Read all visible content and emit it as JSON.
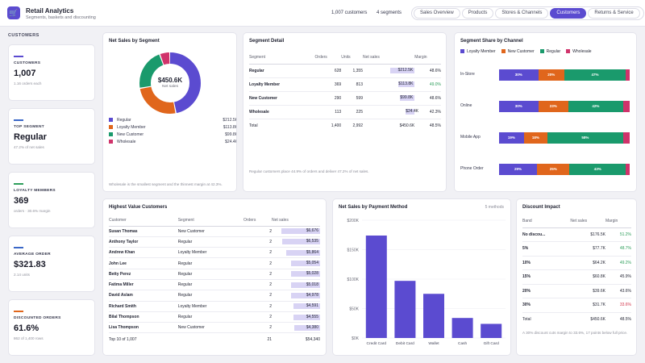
{
  "app": {
    "title": "Retail Analytics",
    "subtitle": "Segments, baskets and discounting"
  },
  "header_stats": {
    "customers": "1,007 customers",
    "segments": "4 segments"
  },
  "tabs": [
    {
      "label": "Sales Overview",
      "active": false
    },
    {
      "label": "Products",
      "active": false
    },
    {
      "label": "Stores & Channels",
      "active": false
    },
    {
      "label": "Customers",
      "active": true
    },
    {
      "label": "Returns & Service",
      "active": false
    }
  ],
  "sidebar": {
    "heading": "CUSTOMERS",
    "kpis": [
      {
        "label": "CUSTOMERS",
        "value": "1,007",
        "sub": "1.16 orders each",
        "color": "#5b4bd0"
      },
      {
        "label": "TOP SEGMENT",
        "value": "Regular",
        "sub": "47.2% of net sales",
        "color": "#3a67c7"
      },
      {
        "label": "LOYALTY MEMBERS",
        "value": "369",
        "sub": "orders · 30.6% margin",
        "color": "#2e9e5b"
      },
      {
        "label": "AVERAGE ORDER",
        "value": "$321.83",
        "sub": "2.14 units",
        "color": "#3a67c7"
      },
      {
        "label": "DISCOUNTED ORDERS",
        "value": "61.6%",
        "sub": "862 of 1,400 rows",
        "color": "#e0661c"
      }
    ]
  },
  "net_sales_by_segment": {
    "title": "Net Sales by Segment",
    "center_value": "$450.6K",
    "center_label": "Net sales",
    "segments": [
      {
        "name": "Regular",
        "value": "$212.5K",
        "amount": 212.5,
        "color": "#5b4bd0"
      },
      {
        "name": "Loyalty Member",
        "value": "$113.8K",
        "amount": 113.8,
        "color": "#e0661c"
      },
      {
        "name": "New Customer",
        "value": "$99.8K",
        "amount": 99.8,
        "color": "#1a9a6c"
      },
      {
        "name": "Wholesale",
        "value": "$24.4K",
        "amount": 24.4,
        "color": "#d0336b"
      }
    ],
    "note": "Wholesale is the smallest segment and the thinnest margin at 42.3%."
  },
  "segment_detail": {
    "title": "Segment Detail",
    "columns": [
      "Segment",
      "Orders",
      "Units",
      "Net sales",
      "Margin"
    ],
    "rows": [
      {
        "segment": "Regular",
        "orders": "628",
        "units": "1,355",
        "net": "$212.5K",
        "share": 1.0,
        "margin": "48.6%",
        "margin_class": ""
      },
      {
        "segment": "Loyalty Member",
        "orders": "369",
        "units": "813",
        "net": "$113.8K",
        "share": 0.54,
        "margin": "49.0%",
        "margin_class": "g"
      },
      {
        "segment": "New Customer",
        "orders": "290",
        "units": "599",
        "net": "$99.8K",
        "share": 0.47,
        "margin": "48.6%",
        "margin_class": ""
      },
      {
        "segment": "Wholesale",
        "orders": "113",
        "units": "225",
        "net": "$24.4K",
        "share": 0.12,
        "margin": "42.3%",
        "margin_class": ""
      }
    ],
    "total": {
      "label": "Total",
      "orders": "1,400",
      "units": "2,992",
      "net": "$450.6K",
      "margin": "48.5%"
    },
    "note": "Regular customers place 44.9% of orders and deliver 47.2% of net sales."
  },
  "segment_share": {
    "title": "Segment Share by Channel",
    "legend": [
      {
        "name": "Loyalty Member",
        "color": "#5b4bd0"
      },
      {
        "name": "New Customer",
        "color": "#e0661c"
      },
      {
        "name": "Regular",
        "color": "#1a9a6c"
      },
      {
        "name": "Wholesale",
        "color": "#d0336b"
      }
    ],
    "channels": [
      {
        "name": "In-Store",
        "shares": [
          30,
          20,
          47,
          3
        ],
        "labels": [
          "30%",
          "20%",
          "47%",
          ""
        ]
      },
      {
        "name": "Online",
        "shares": [
          30,
          23,
          42,
          5
        ],
        "labels": [
          "30%",
          "23%",
          "42%",
          ""
        ]
      },
      {
        "name": "Mobile App",
        "shares": [
          19,
          18,
          58,
          5
        ],
        "labels": [
          "19%",
          "18%",
          "58%",
          ""
        ]
      },
      {
        "name": "Phone Order",
        "shares": [
          29,
          25,
          43,
          3
        ],
        "labels": [
          "29%",
          "25%",
          "43%",
          ""
        ]
      }
    ]
  },
  "highest_value_customers": {
    "title": "Highest Value Customers",
    "columns": [
      "Customer",
      "Segment",
      "Orders",
      "Net sales"
    ],
    "rows": [
      {
        "customer": "Susan Thomas",
        "segment": "New Customer",
        "orders": "2",
        "net": "$6,676",
        "share": 1.0
      },
      {
        "customer": "Anthony Taylor",
        "segment": "Regular",
        "orders": "2",
        "net": "$6,535",
        "share": 0.98
      },
      {
        "customer": "Andrew Khan",
        "segment": "Loyalty Member",
        "orders": "2",
        "net": "$5,864",
        "share": 0.88
      },
      {
        "customer": "John Lee",
        "segment": "Regular",
        "orders": "2",
        "net": "$5,054",
        "share": 0.76
      },
      {
        "customer": "Betty Perez",
        "segment": "Regular",
        "orders": "2",
        "net": "$5,028",
        "share": 0.75
      },
      {
        "customer": "Fatima Miller",
        "segment": "Regular",
        "orders": "2",
        "net": "$5,018",
        "share": 0.75
      },
      {
        "customer": "David Aslam",
        "segment": "Regular",
        "orders": "2",
        "net": "$4,978",
        "share": 0.75
      },
      {
        "customer": "Richard Smith",
        "segment": "Loyalty Member",
        "orders": "2",
        "net": "$4,591",
        "share": 0.69
      },
      {
        "customer": "Bilal Thompson",
        "segment": "Regular",
        "orders": "2",
        "net": "$4,555",
        "share": 0.68
      },
      {
        "customer": "Lisa Thompson",
        "segment": "New Customer",
        "orders": "2",
        "net": "$4,380",
        "share": 0.66
      }
    ],
    "footer": {
      "label": "Top 10 of 1,007",
      "orders": "21",
      "net": "$54,340"
    }
  },
  "chart_data": {
    "type": "bar",
    "title": "Net Sales by Payment Method",
    "badge": "5 methods",
    "categories": [
      "Credit Card",
      "Debit Card",
      "Wallet",
      "Cash",
      "Gift Card"
    ],
    "values": [
      174,
      97,
      75,
      34,
      24
    ],
    "ylim": [
      0,
      200
    ],
    "yticks": [
      "$0K",
      "$50K",
      "$100K",
      "$150K",
      "$200K"
    ],
    "color": "#5b4bd0"
  },
  "discount_impact": {
    "title": "Discount Impact",
    "columns": [
      "Band",
      "Net sales",
      "Margin"
    ],
    "rows": [
      {
        "band": "No discou...",
        "net": "$176.5K",
        "margin": "51.2%",
        "cls": "g"
      },
      {
        "band": "5%",
        "net": "$77.7K",
        "margin": "48.7%",
        "cls": "g"
      },
      {
        "band": "10%",
        "net": "$64.2K",
        "margin": "49.2%",
        "cls": "g"
      },
      {
        "band": "15%",
        "net": "$60.8K",
        "margin": "45.9%",
        "cls": ""
      },
      {
        "band": "20%",
        "net": "$39.6K",
        "margin": "43.6%",
        "cls": ""
      },
      {
        "band": "30%",
        "net": "$31.7K",
        "margin": "33.6%",
        "cls": "r"
      }
    ],
    "total": {
      "band": "Total",
      "net": "$450.6K",
      "margin": "48.5%"
    },
    "note": "A 30% discount cuts margin to 33.6%, 17 points below full price."
  }
}
